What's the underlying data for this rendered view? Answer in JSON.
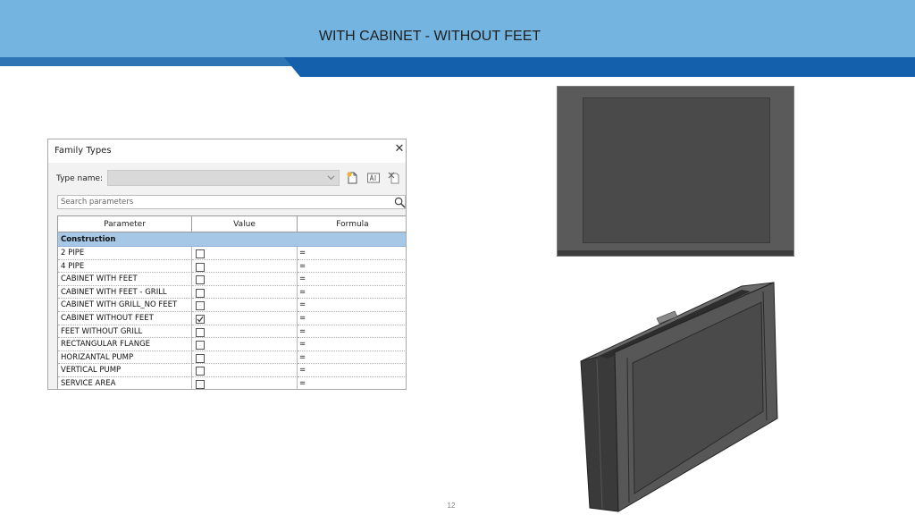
{
  "slide": {
    "title": "WITH CABINET - WITHOUT FEET",
    "page_number": "12"
  },
  "dialog": {
    "title": "Family Types",
    "close_icon": "close-icon",
    "type_name_label": "Type name:",
    "type_name_value": "",
    "toolbar_icons": [
      "new-type-icon",
      "rename-type-icon",
      "delete-type-icon"
    ],
    "search_placeholder": "Search parameters",
    "columns": [
      "Parameter",
      "Value",
      "Formula"
    ],
    "group": "Construction",
    "rows": [
      {
        "name": "2 PIPE",
        "checked": false,
        "formula": "="
      },
      {
        "name": "4 PIPE",
        "checked": false,
        "formula": "="
      },
      {
        "name": "CABINET WITH FEET",
        "checked": false,
        "formula": "="
      },
      {
        "name": "CABINET WITH FEET - GRILL",
        "checked": false,
        "formula": "="
      },
      {
        "name": "CABINET WITH GRILL_NO FEET",
        "checked": false,
        "formula": "="
      },
      {
        "name": "CABINET WITHOUT FEET",
        "checked": true,
        "formula": "="
      },
      {
        "name": "FEET WITHOUT GRILL",
        "checked": false,
        "formula": "="
      },
      {
        "name": "RECTANGULAR FLANGE",
        "checked": false,
        "formula": "="
      },
      {
        "name": "HORIZANTAL PUMP",
        "checked": false,
        "formula": "="
      },
      {
        "name": "VERTICAL PUMP",
        "checked": false,
        "formula": "="
      },
      {
        "name": "SERVICE AREA",
        "checked": false,
        "formula": "="
      }
    ]
  },
  "colors": {
    "header_light": "#73b4e0",
    "header_dark": "#1560ad",
    "group_row": "#a6c8e6"
  }
}
